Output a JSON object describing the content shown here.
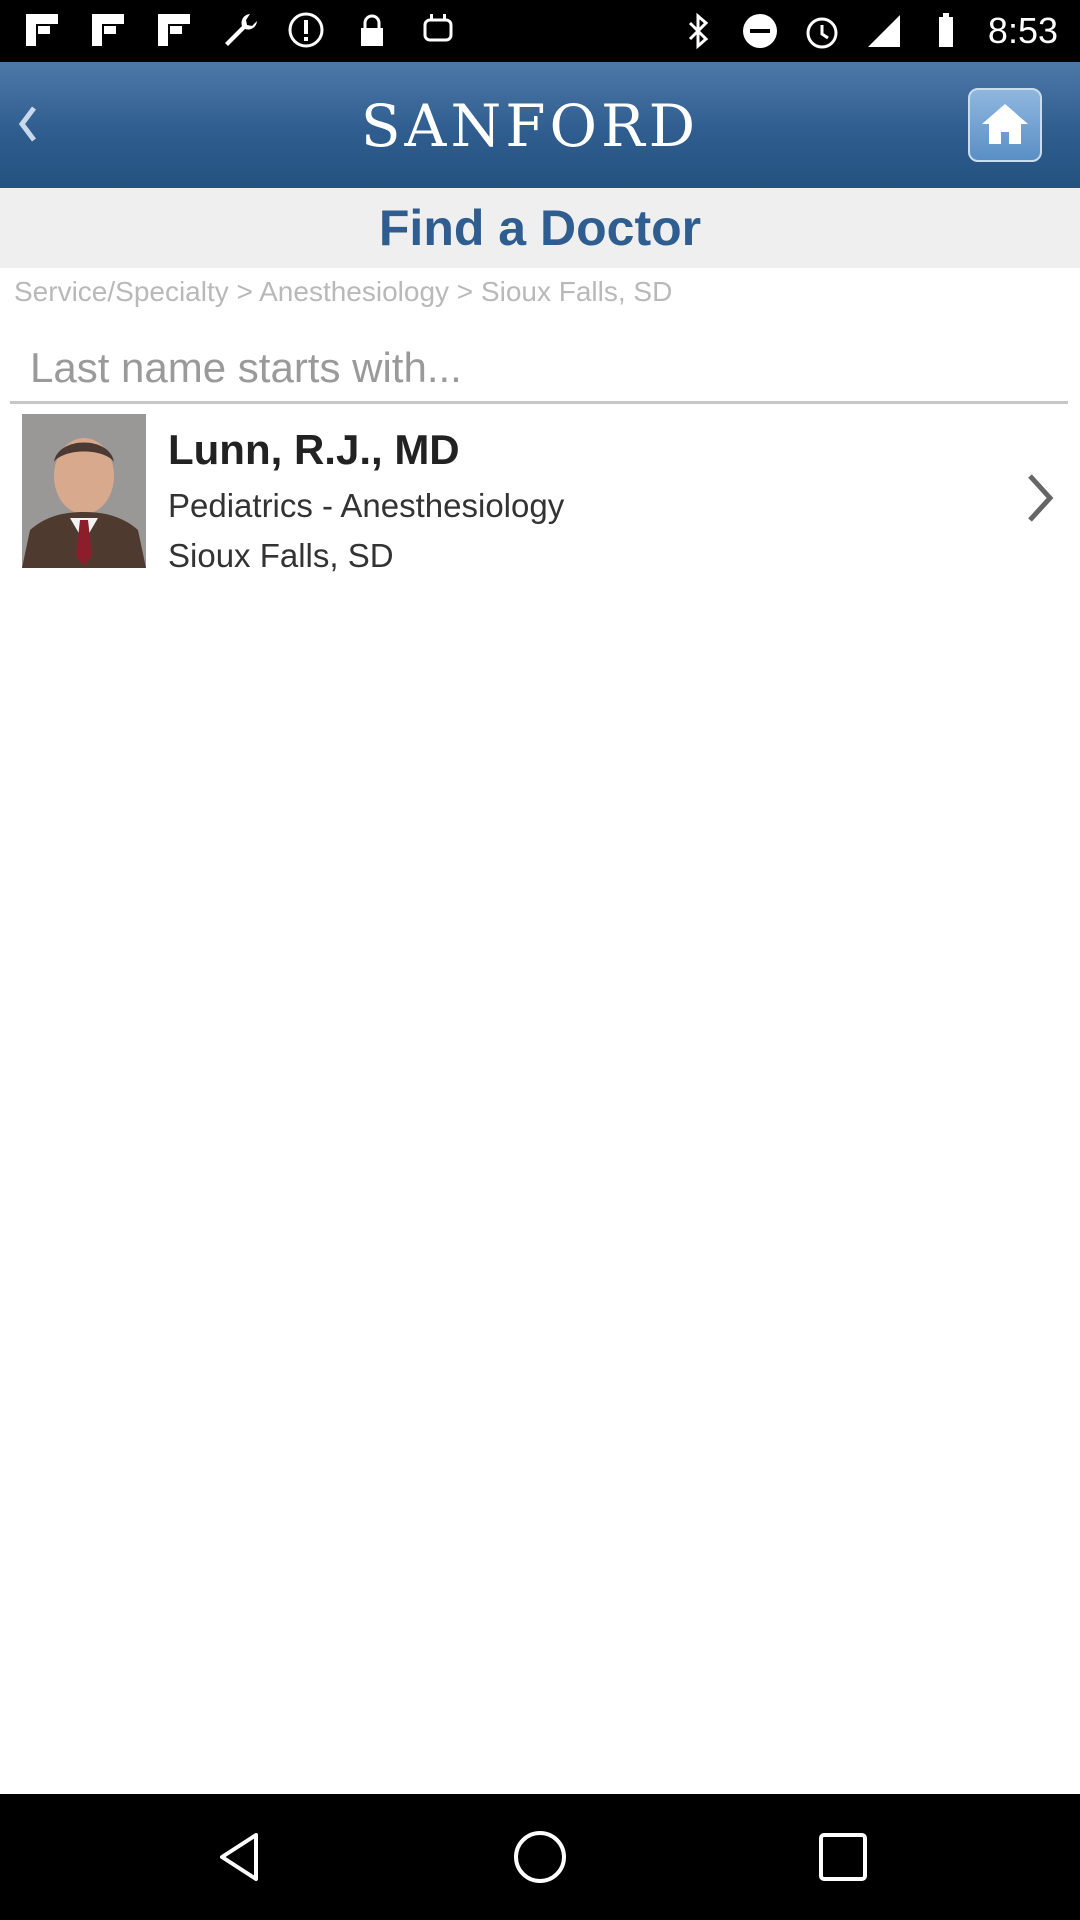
{
  "status_bar": {
    "time": "8:53",
    "left_icons": [
      "flipboard-icon",
      "flipboard-icon",
      "flipboard-icon",
      "wrench-icon",
      "info-icon",
      "lock-icon",
      "android-icon"
    ],
    "right_icons": [
      "bluetooth-icon",
      "do-not-disturb-icon",
      "alarm-icon",
      "signal-icon",
      "battery-icon"
    ]
  },
  "header": {
    "logo_text": "SANFORD",
    "back_icon": "chevron-left-icon",
    "home_icon": "home-icon",
    "colors": {
      "header": "#2f5d8f",
      "title": "#2f5d8f"
    }
  },
  "page": {
    "title": "Find a Doctor",
    "breadcrumb": "Service/Specialty > Anesthesiology > Sioux Falls, SD"
  },
  "search": {
    "placeholder": "Last name starts with...",
    "value": ""
  },
  "results": [
    {
      "name": "Lunn, R.J., MD",
      "specialty": "Pediatrics - Anesthesiology",
      "location": "Sioux Falls, SD",
      "icon": "chevron-right-icon"
    }
  ],
  "nav_bar": {
    "buttons": [
      "back-triangle-icon",
      "home-circle-icon",
      "recents-square-icon"
    ]
  }
}
